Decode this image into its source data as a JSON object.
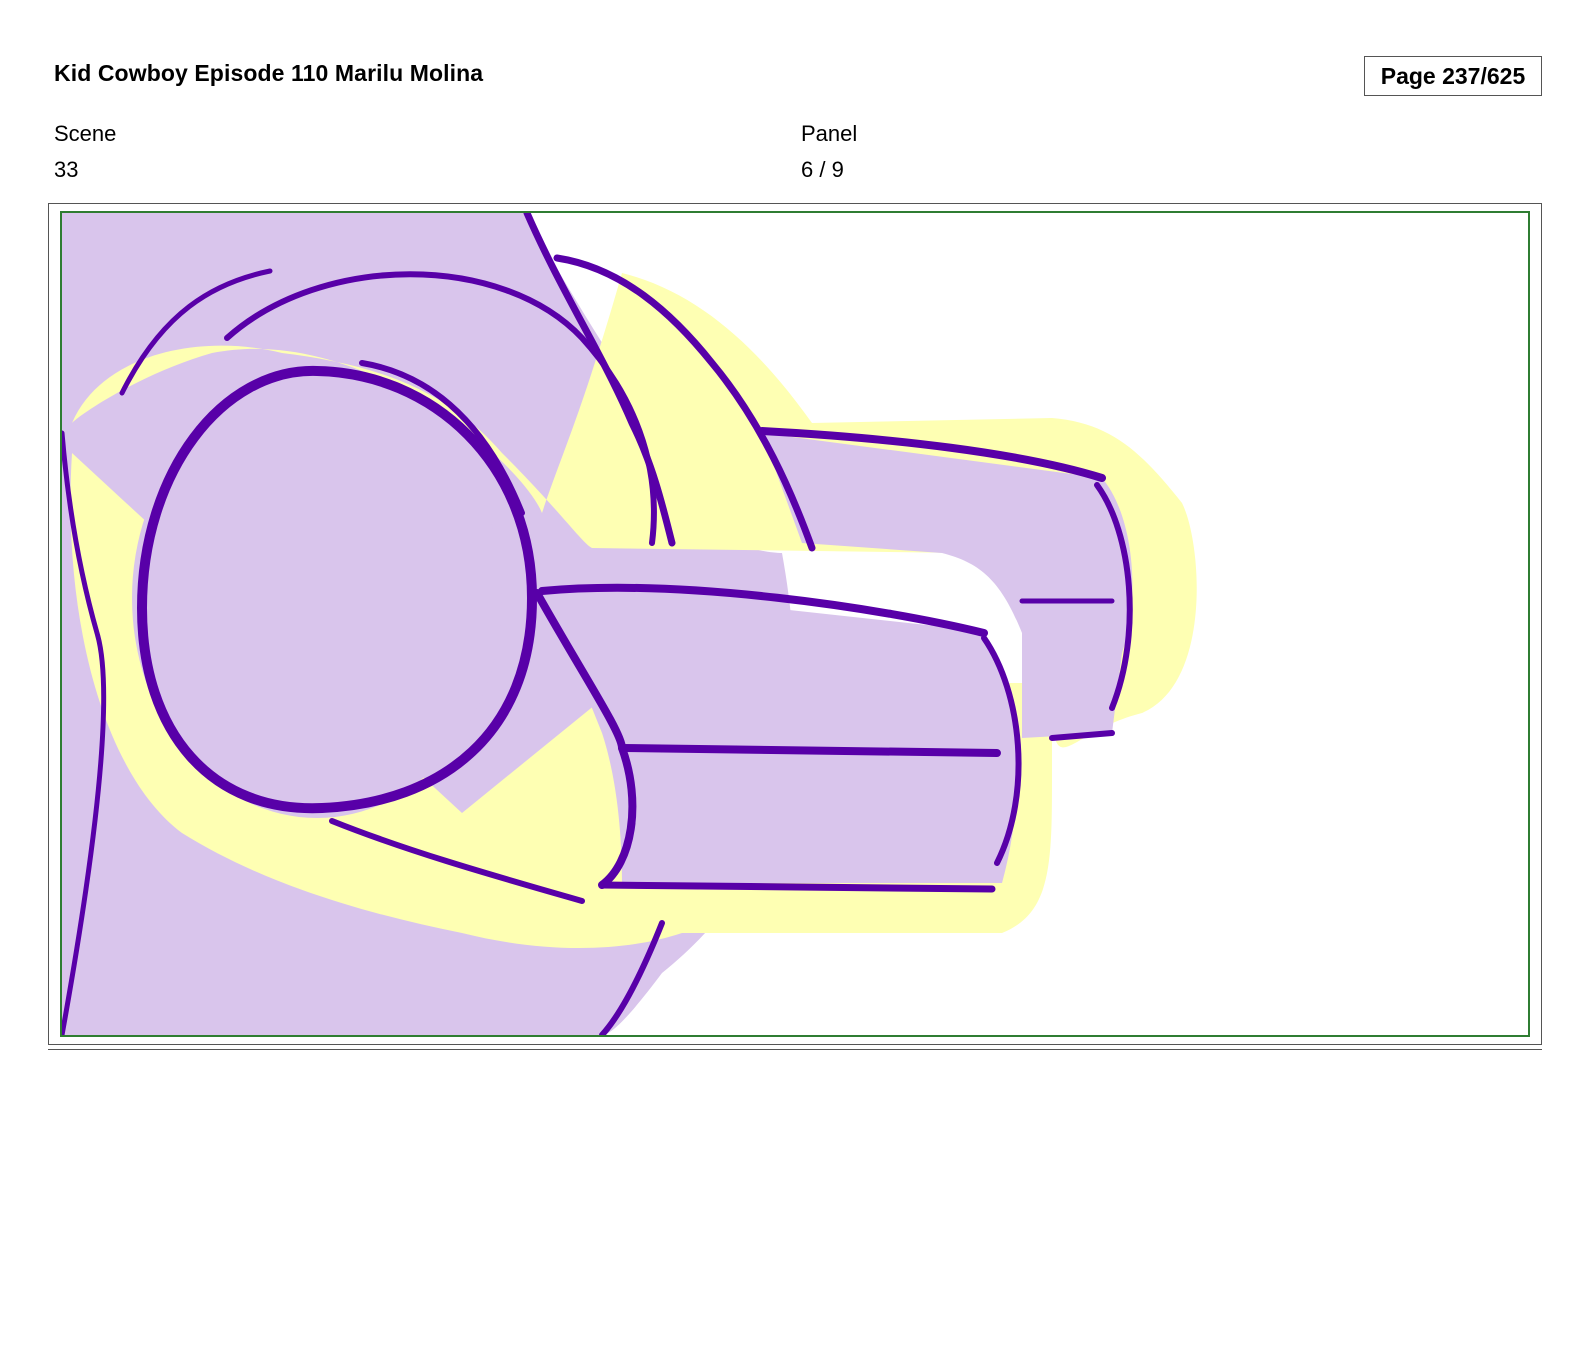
{
  "header": {
    "title": "Kid Cowboy Episode 110 Marilu Molina",
    "page_counter": "Page 237/625"
  },
  "meta": {
    "scene_label": "Scene",
    "scene_value": "33",
    "panel_label": "Panel",
    "panel_value": "6 / 9"
  },
  "panel": {
    "drawing": "storyboard-sketch-cylinders",
    "colors": {
      "fill": "#d9c5ec",
      "outline": "#5800a8",
      "highlight": "#feffb3",
      "frame_border": "#2f7d32"
    }
  }
}
